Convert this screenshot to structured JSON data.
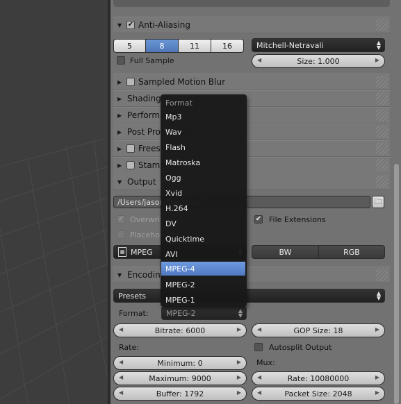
{
  "antialiasing": {
    "header": "Anti-Aliasing",
    "samples": [
      "5",
      "8",
      "11",
      "16"
    ],
    "filter": "Mitchell-Netravali",
    "full_sample_label": "Full Sample",
    "size_label": "Size: 1.000"
  },
  "panels": {
    "sampled_motion_blur": "Sampled Motion Blur",
    "shading": "Shading",
    "performance": "Performance",
    "post_processing": "Post Processing",
    "freestyle": "Freestyle",
    "stamp": "Stamp",
    "output": "Output",
    "encoding": "Encoding"
  },
  "output": {
    "path": "/Users/jason/Desktop/",
    "overwrite_label": "Overwrite",
    "placeholders_label": "Placeholders",
    "file_extensions_label": "File Extensions",
    "format_value": "MPEG",
    "bw": "BW",
    "rgb": "RGB"
  },
  "format_menu": {
    "title": "Format",
    "items": [
      "Mp3",
      "Wav",
      "Flash",
      "Matroska",
      "Ogg",
      "Xvid",
      "H.264",
      "DV",
      "Quicktime",
      "AVI",
      "MPEG-4",
      "MPEG-2",
      "MPEG-1"
    ],
    "highlighted": "MPEG-4"
  },
  "encoding": {
    "presets": "Presets",
    "format_label": "Format:",
    "format_value": "MPEG-2",
    "bitrate": "Bitrate: 6000",
    "gop_size": "GOP Size: 18",
    "rate_label": "Rate:",
    "autosplit_label": "Autosplit Output",
    "minimum": "Minimum: 0",
    "mux_label": "Mux:",
    "maximum": "Maximum: 9000",
    "mux_rate": "Rate: 10080000",
    "buffer": "Buffer: 1792",
    "packet_size": "Packet Size: 2048"
  },
  "colors": {
    "panel_bg": "#727272",
    "selected_blue": "#5a86cc",
    "menu_bg": "#181818"
  }
}
